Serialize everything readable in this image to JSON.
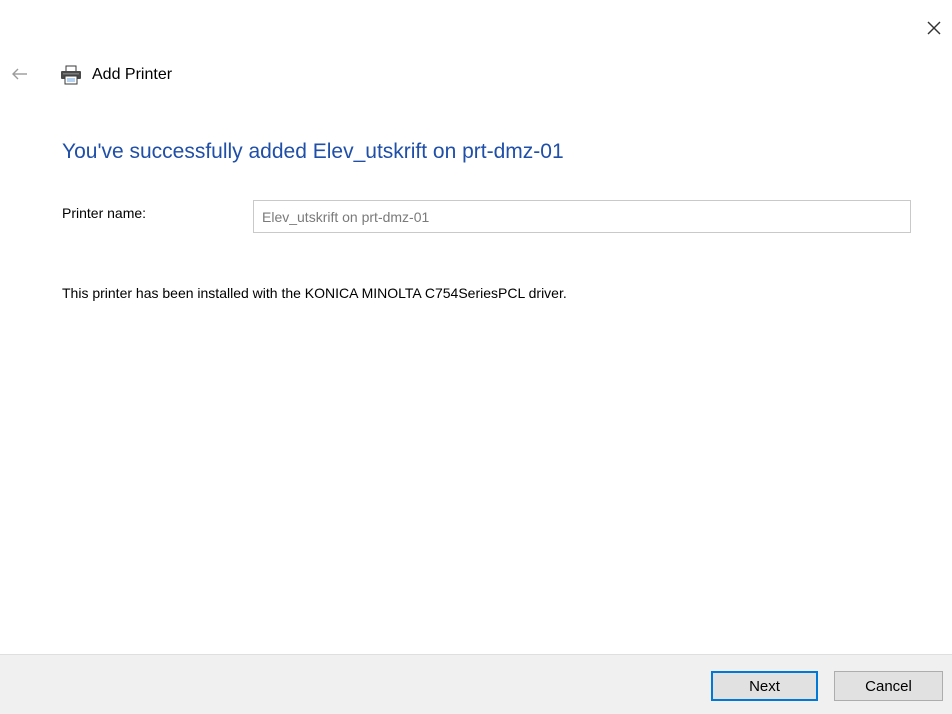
{
  "window": {
    "title": "Add Printer",
    "close_icon": "close-icon",
    "back_icon": "back-arrow-icon",
    "printer_icon": "printer-icon"
  },
  "main": {
    "heading": "You've successfully added Elev_utskrift on prt-dmz-01",
    "printer_name_label": "Printer name:",
    "printer_name_value": "Elev_utskrift on prt-dmz-01",
    "driver_message": "This printer has been installed with the KONICA MINOLTA C754SeriesPCL driver."
  },
  "footer": {
    "next_label": "Next",
    "cancel_label": "Cancel"
  },
  "colors": {
    "heading": "#1f4fa8",
    "default_button_border": "#0078d7",
    "footer_background": "#f0f0f0"
  }
}
